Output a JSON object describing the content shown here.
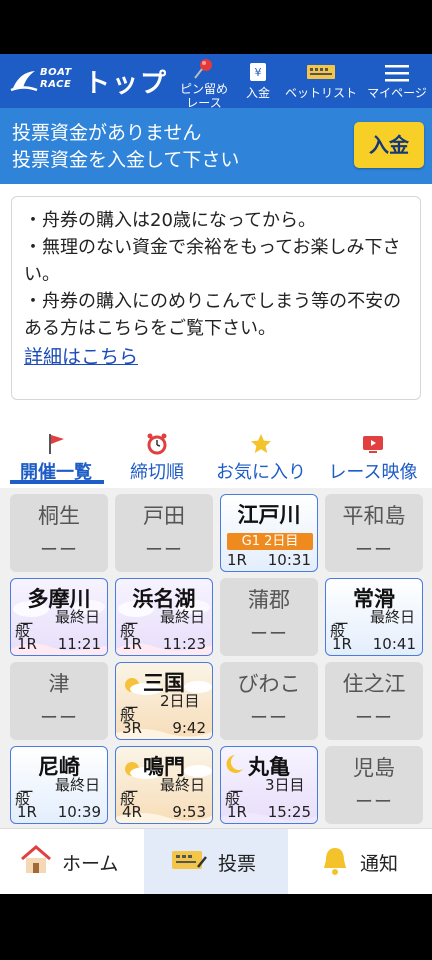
{
  "header": {
    "logo_line1": "BOAT",
    "logo_line2": "RACE",
    "title": "トップ",
    "buttons": [
      {
        "label_line1": "ピン留め",
        "label_line2": "レース",
        "icon": "pin-icon"
      },
      {
        "label": "入金",
        "icon": "deposit-icon"
      },
      {
        "label": "ベットリスト",
        "icon": "betlist-icon"
      },
      {
        "label": "マイページ",
        "icon": "menu-icon"
      }
    ]
  },
  "warning": {
    "line1": "投票資金がありません",
    "line2": "投票資金を入金して下さい",
    "deposit_button": "入金"
  },
  "notice": {
    "lines": [
      "・舟券の購入は20歳になってから。",
      "・無理のない資金で余裕をもってお楽しみ下さい。",
      "・舟券の購入にのめりこんでしまう等の不安のある方はこちらをご覧下さい。"
    ],
    "link": "詳細はこちら"
  },
  "tabs": [
    {
      "label": "開催一覧",
      "icon": "flag-icon",
      "active": true
    },
    {
      "label": "締切順",
      "icon": "alarm-clock-icon"
    },
    {
      "label": "お気に入り",
      "icon": "star-icon"
    },
    {
      "label": "レース映像",
      "icon": "video-icon"
    }
  ],
  "venues": [
    {
      "name": "桐生",
      "status": "ーー"
    },
    {
      "name": "戸田",
      "status": "ーー"
    },
    {
      "name": "江戸川",
      "grade": "G1 2日目",
      "race": "1R",
      "time": "10:31"
    },
    {
      "name": "平和島",
      "status": "ーー"
    },
    {
      "name": "多摩川",
      "dash": "ー",
      "type": "般",
      "day": "最終日",
      "race": "1R",
      "time": "11:21"
    },
    {
      "name": "浜名湖",
      "dash": "ー",
      "type": "般",
      "day": "最終日",
      "race": "1R",
      "time": "11:23"
    },
    {
      "name": "蒲郡",
      "status": "ーー"
    },
    {
      "name": "常滑",
      "dash": "ー",
      "type": "般",
      "day": "最終日",
      "race": "1R",
      "time": "10:41"
    },
    {
      "name": "津",
      "status": "ーー"
    },
    {
      "name": "三国",
      "dash": "ー",
      "type": "般",
      "day": "2日目",
      "race": "3R",
      "time": "9:42"
    },
    {
      "name": "びわこ",
      "status": "ーー"
    },
    {
      "name": "住之江",
      "status": "ーー"
    },
    {
      "name": "尼崎",
      "dash": "ー",
      "type": "般",
      "day": "最終日",
      "race": "1R",
      "time": "10:39"
    },
    {
      "name": "鳴門",
      "dash": "ー",
      "type": "般",
      "day": "最終日",
      "race": "4R",
      "time": "9:53"
    },
    {
      "name": "丸亀",
      "dash": "ー",
      "type": "般",
      "day": "3日目",
      "race": "1R",
      "time": "15:25"
    },
    {
      "name": "児島",
      "status": "ーー"
    }
  ],
  "bottom_nav": [
    {
      "label": "ホーム",
      "icon": "home-icon"
    },
    {
      "label": "投票",
      "icon": "ticket-icon",
      "selected": true
    },
    {
      "label": "通知",
      "icon": "bell-icon"
    }
  ],
  "colors": {
    "header": "#1e5cc6",
    "warning_bar": "#2f83d8",
    "deposit": "#f7cf27"
  }
}
